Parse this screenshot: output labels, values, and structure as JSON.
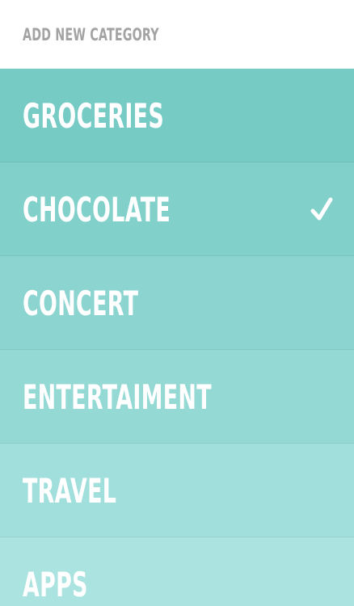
{
  "header": {
    "add_label": "ADD NEW CATEGORY"
  },
  "categories": [
    {
      "label": "GROCERIES",
      "selected": false,
      "color": "#76cbc5"
    },
    {
      "label": "CHOCOLATE",
      "selected": true,
      "color": "#82d0ca"
    },
    {
      "label": "CONCERT",
      "selected": false,
      "color": "#8bd4cf"
    },
    {
      "label": "ENTERTAIMENT",
      "selected": false,
      "color": "#95d9d4"
    },
    {
      "label": "TRAVEL",
      "selected": false,
      "color": "#a0dfdb"
    },
    {
      "label": "APPS",
      "selected": false,
      "color": "#aae3df"
    }
  ],
  "selected_icon": "checkmark-icon"
}
